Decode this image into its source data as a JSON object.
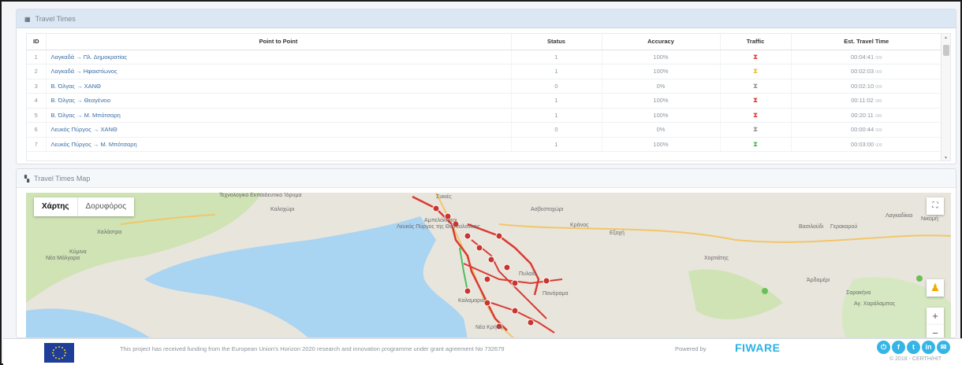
{
  "travel_times": {
    "title": "Travel Times",
    "columns": [
      "ID",
      "Point to Point",
      "Status",
      "Accuracy",
      "Traffic",
      "Est. Travel Time"
    ],
    "rows": [
      {
        "id": "1",
        "route": "Λαγκαδά → Πλ. Δημοκρατίας",
        "status": "1",
        "accuracy": "100%",
        "traffic": "red",
        "time": "00:04:41",
        "ms": "000"
      },
      {
        "id": "2",
        "route": "Λαγκαδά → Ηφαιστίωνος",
        "status": "1",
        "accuracy": "100%",
        "traffic": "yellow",
        "time": "00:02:03",
        "ms": "000"
      },
      {
        "id": "3",
        "route": "Β. Όλγας → ΧΑΝΘ",
        "status": "0",
        "accuracy": "0%",
        "traffic": "gray",
        "time": "00:02:10",
        "ms": "000"
      },
      {
        "id": "4",
        "route": "Β. Όλγας → Θεαγένειο",
        "status": "1",
        "accuracy": "100%",
        "traffic": "red",
        "time": "00:11:02",
        "ms": "000"
      },
      {
        "id": "5",
        "route": "Β. Όλγας → Μ. Μπότσαρη",
        "status": "1",
        "accuracy": "100%",
        "traffic": "red",
        "time": "00:20:11",
        "ms": "000"
      },
      {
        "id": "6",
        "route": "Λευκός Πύργος → ΧΑΝΘ",
        "status": "0",
        "accuracy": "0%",
        "traffic": "gray",
        "time": "00:00:44",
        "ms": "000"
      },
      {
        "id": "7",
        "route": "Λευκός Πύργος → Μ. Μπότσαρη",
        "status": "1",
        "accuracy": "100%",
        "traffic": "green",
        "time": "00:03:00",
        "ms": "000"
      }
    ],
    "traffic_colors": {
      "red": "#e0433b",
      "yellow": "#e8c23a",
      "gray": "#9a9a9a",
      "green": "#4cbf5d"
    }
  },
  "map": {
    "title": "Travel Times Map",
    "type_map": "Χάρτης",
    "type_satellite": "Δορυφόρος",
    "place_labels": [
      "Τεχνολογικό Εκπαιδευτικό Ίδρυμα",
      "Καλοχώρι",
      "Συκιές",
      "Αμπελόκηποι",
      "Ασβεστοχώρι",
      "Κράνος",
      "Εξοχή",
      "Χορτιάτης",
      "Βασιλούδι",
      "Γερακαρού",
      "Λαγκαδίκια",
      "Νικομή",
      "Χαλάστρα",
      "Κύμινα",
      "Νέα Μάλγαρα",
      "Λευκός Πύργος της Θεσσαλονίκης",
      "Πυλαία",
      "Πανόραμα",
      "Καλαμαριά",
      "Νέα Κρήνη",
      "Άρδαμέρι",
      "Σαρακήνα",
      "Αγ. Χαράλαμπος"
    ]
  },
  "footer": {
    "funding_text": "This project has received funding from the European Union's Horizon 2020 research and innovation programme under grant agreement No 732679",
    "powered_by": "Powered by",
    "brand": "FIWARE",
    "copyright": "© 2018 - CERTH/HIT"
  }
}
